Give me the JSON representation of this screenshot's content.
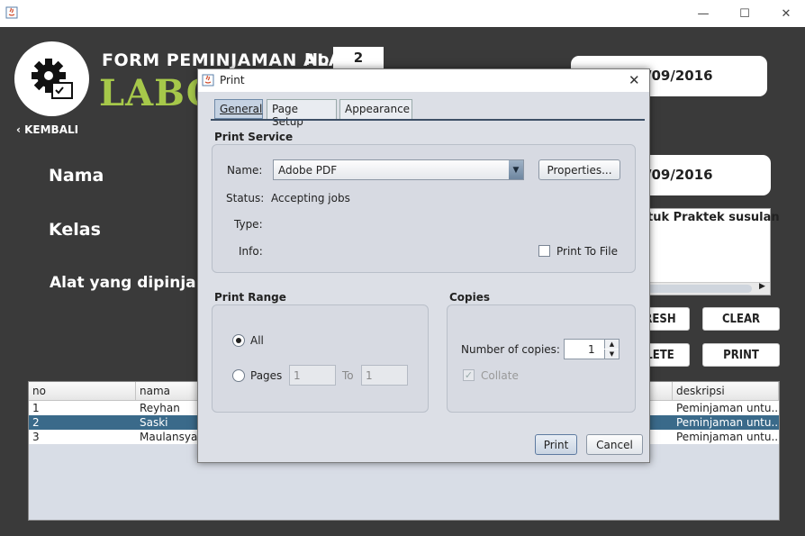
{
  "window": {
    "minimize_glyph": "—",
    "maximize_glyph": "☐",
    "close_glyph": "✕"
  },
  "form": {
    "title_line1": "FORM PEMINJAMAN ALAT",
    "title_line2": "LABOR",
    "no_label": "No",
    "no_value": "2",
    "back_label": "‹ KEMBALI",
    "date1_value": "/09/2016",
    "date2_value": "/09/2016",
    "nama_label": "Nama",
    "kelas_label": "Kelas",
    "alat_label": "Alat yang dipinjam",
    "desc_text": "tuk Praktek susulan",
    "buttons": {
      "refresh": "RESH",
      "clear": "CLEAR",
      "delete": "LETE",
      "print": "PRINT"
    }
  },
  "table": {
    "columns": [
      "no",
      "nama",
      "deskripsi"
    ],
    "rows": [
      {
        "no": "1",
        "nama": "Reyhan",
        "deskripsi": "Peminjaman untu..."
      },
      {
        "no": "2",
        "nama": "Saski",
        "deskripsi": "Peminjaman untu..."
      },
      {
        "no": "3",
        "nama": "Maulansyah",
        "deskripsi": "Peminjaman untu..."
      }
    ],
    "selected_row": 1
  },
  "dialog": {
    "title": "Print",
    "tabs": [
      "General",
      "Page Setup",
      "Appearance"
    ],
    "active_tab": 0,
    "print_service": {
      "heading": "Print Service",
      "name_label": "Name:",
      "name_value": "Adobe PDF",
      "properties_button": "Properties...",
      "status_label": "Status:",
      "status_value": "Accepting jobs",
      "type_label": "Type:",
      "info_label": "Info:",
      "print_to_file_label": "Print To File",
      "print_to_file_checked": false
    },
    "print_range": {
      "heading": "Print Range",
      "all_label": "All",
      "pages_label": "Pages",
      "from_value": "1",
      "to_label": "To",
      "to_value": "1",
      "selected": "All"
    },
    "copies": {
      "heading": "Copies",
      "number_label": "Number of copies:",
      "number_value": "1",
      "collate_label": "Collate",
      "collate_checked": true,
      "collate_enabled": false
    },
    "print_button": "Print",
    "cancel_button": "Cancel"
  }
}
